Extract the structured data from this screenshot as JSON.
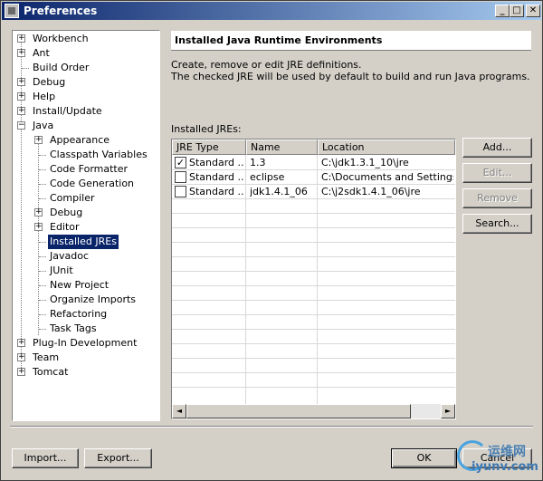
{
  "window": {
    "title": "Preferences",
    "controls": {
      "minimize": "_",
      "maximize": "□",
      "close": "✕"
    }
  },
  "tree": {
    "items": [
      {
        "label": "Workbench",
        "expander": "+"
      },
      {
        "label": "Ant",
        "expander": "+"
      },
      {
        "label": "Build Order",
        "expander": ""
      },
      {
        "label": "Debug",
        "expander": "+"
      },
      {
        "label": "Help",
        "expander": "+"
      },
      {
        "label": "Install/Update",
        "expander": "+"
      },
      {
        "label": "Java",
        "expander": "−"
      },
      {
        "label": "Appearance",
        "expander": "+"
      },
      {
        "label": "Classpath Variables",
        "expander": ""
      },
      {
        "label": "Code Formatter",
        "expander": ""
      },
      {
        "label": "Code Generation",
        "expander": ""
      },
      {
        "label": "Compiler",
        "expander": ""
      },
      {
        "label": "Debug",
        "expander": "+"
      },
      {
        "label": "Editor",
        "expander": "+"
      },
      {
        "label": "Installed JREs",
        "expander": "",
        "selected": true
      },
      {
        "label": "Javadoc",
        "expander": ""
      },
      {
        "label": "JUnit",
        "expander": ""
      },
      {
        "label": "New Project",
        "expander": ""
      },
      {
        "label": "Organize Imports",
        "expander": ""
      },
      {
        "label": "Refactoring",
        "expander": ""
      },
      {
        "label": "Task Tags",
        "expander": ""
      },
      {
        "label": "Plug-In Development",
        "expander": "+"
      },
      {
        "label": "Team",
        "expander": "+"
      },
      {
        "label": "Tomcat",
        "expander": "+"
      }
    ]
  },
  "page": {
    "title": "Installed Java Runtime Environments",
    "description_line1": "Create, remove or edit JRE definitions.",
    "description_line2": "The checked JRE will be used by default to build and run Java programs.",
    "list_label": "Installed JREs:"
  },
  "table": {
    "columns": [
      "JRE Type",
      "Name",
      "Location"
    ],
    "rows": [
      {
        "checked": true,
        "type": "Standard ...",
        "name": "1.3",
        "location": "C:\\jdk1.3.1_10\\jre"
      },
      {
        "checked": false,
        "type": "Standard ...",
        "name": "eclipse",
        "location": "C:\\Documents and Settings\\..."
      },
      {
        "checked": false,
        "type": "Standard ...",
        "name": "jdk1.4.1_06",
        "location": "C:\\j2sdk1.4.1_06\\jre"
      }
    ],
    "scroll_left": "◄",
    "scroll_right": "►"
  },
  "side_buttons": {
    "add": "Add...",
    "edit": "Edit...",
    "remove": "Remove",
    "search": "Search..."
  },
  "footer": {
    "import": "Import...",
    "export": "Export...",
    "ok": "OK",
    "cancel": "Cancel"
  },
  "watermark": {
    "text": "运维网",
    "url": "iyunv.com"
  }
}
